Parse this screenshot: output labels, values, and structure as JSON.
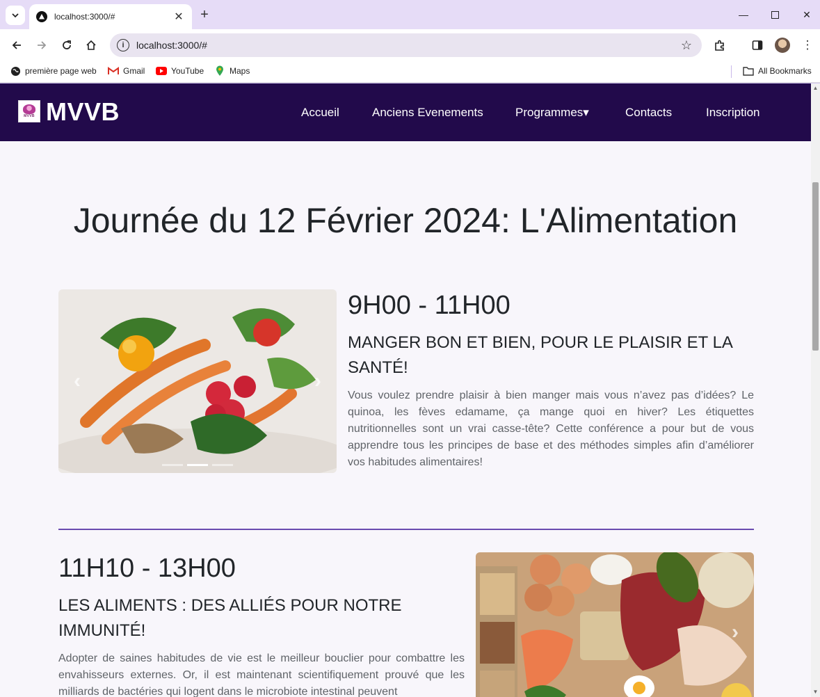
{
  "browser": {
    "tab_title": "localhost:3000/#",
    "url": "localhost:3000/#",
    "bookmarks": [
      {
        "label": "première page web",
        "icon": "globe-icon"
      },
      {
        "label": "Gmail",
        "icon": "gmail-icon"
      },
      {
        "label": "YouTube",
        "icon": "youtube-icon"
      },
      {
        "label": "Maps",
        "icon": "maps-pin-icon"
      }
    ],
    "all_bookmarks": "All Bookmarks"
  },
  "site": {
    "brand": "MVVB",
    "logo_text": "MVVB",
    "nav": [
      {
        "label": "Accueil"
      },
      {
        "label": "Anciens Evenements"
      },
      {
        "label": "Programmes▾"
      },
      {
        "label": "Contacts"
      },
      {
        "label": "Inscription"
      }
    ],
    "accent_color": "#220a4b",
    "divider_color": "#6a4bb0"
  },
  "page": {
    "title": "Journée du 12 Février 2024: L'Alimentation",
    "sessions": [
      {
        "time": "9H00 - 11H00",
        "title": "MANGER BON ET BIEN, POUR LE PLAISIR ET LA SANTÉ!",
        "description": "Vous voulez prendre plaisir à bien manger mais vous n’avez pas d’idées? Le quinoa, les fèves edamame, ça mange quoi en hiver? Les étiquettes nutritionnelles sont un vrai casse-tête? Cette conférence a pour but de vous apprendre tous les principes de base et des méthodes simples afin d’améliorer vos habitudes alimentaires!",
        "carousel": {
          "slides": 3,
          "active": 2
        }
      },
      {
        "time": "11H10 - 13H00",
        "title": "LES ALIMENTS : DES ALLIÉS POUR NOTRE IMMUNITÉ!",
        "description": "Adopter de saines habitudes de vie est le meilleur bouclier pour combattre les envahisseurs externes. Or, il est maintenant scientifiquement prouvé que les milliards de bactéries qui logent dans le microbiote intestinal peuvent"
      }
    ]
  }
}
